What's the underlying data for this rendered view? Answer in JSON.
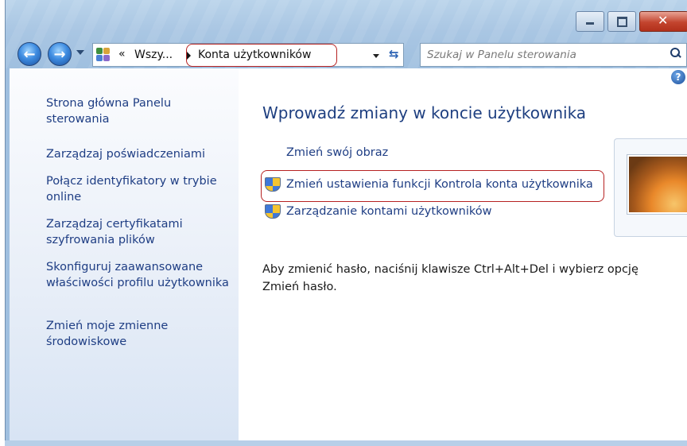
{
  "window": {
    "controls": {
      "minimize": "minimize",
      "maximize": "maximize",
      "close": "close"
    }
  },
  "nav": {
    "back_icon": "back-arrow-icon",
    "forward_icon": "forward-arrow-icon"
  },
  "address_bar": {
    "overflow_label": "«",
    "crumb_truncated": "Wszy...",
    "crumb_current": "Konta użytkowników",
    "refresh_icon": "refresh-icon"
  },
  "search": {
    "placeholder": "Szukaj w Panelu sterowania"
  },
  "sidebar": {
    "items": [
      {
        "label": "Strona główna Panelu sterowania"
      },
      {
        "label": "Zarządzaj poświadczeniami"
      },
      {
        "label": "Połącz identyfikatory w trybie online"
      },
      {
        "label": "Zarządzaj certyfikatami szyfrowania plików"
      },
      {
        "label": "Skonfiguruj zaawansowane właściwości profilu użytkownika"
      },
      {
        "label": "Zmień moje zmienne środowiskowe"
      }
    ]
  },
  "main": {
    "help_label": "?",
    "heading": "Wprowadź zmiany w koncie użytkownika",
    "tasks": [
      {
        "label": "Zmień swój obraz",
        "shield": false
      },
      {
        "label": "Zmień ustawienia funkcji Kontrola konta użytkownika",
        "shield": true
      },
      {
        "label": "Zarządzanie kontami użytkowników",
        "shield": true
      }
    ],
    "password_note": "Aby zmienić hasło, naciśnij klawisze Ctrl+Alt+Del i wybierz opcję Zmień hasło."
  },
  "colors": {
    "link": "#1f3e84",
    "heading": "#1e3f80",
    "highlight": "#b62222"
  }
}
